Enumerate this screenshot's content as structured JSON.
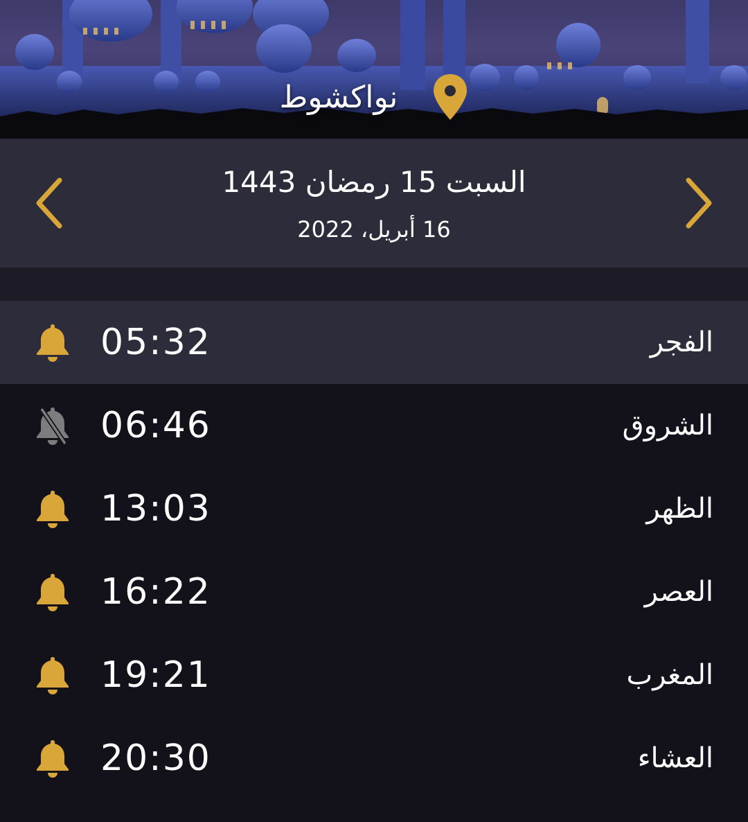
{
  "header": {
    "location_name": "نواكشوط",
    "location_icon": "map-pin-icon"
  },
  "date": {
    "hijri": "السبت 15 رمضان 1443",
    "gregorian": "16 أبريل، 2022",
    "prev_icon": "chevron-left-icon",
    "next_icon": "chevron-right-icon"
  },
  "prayers": [
    {
      "name": "الفجر",
      "time": "05:32",
      "alarm": "on",
      "active": true
    },
    {
      "name": "الشروق",
      "time": "06:46",
      "alarm": "off",
      "active": false
    },
    {
      "name": "الظهر",
      "time": "13:03",
      "alarm": "on",
      "active": false
    },
    {
      "name": "العصر",
      "time": "16:22",
      "alarm": "on",
      "active": false
    },
    {
      "name": "المغرب",
      "time": "19:21",
      "alarm": "on",
      "active": false
    },
    {
      "name": "العشاء",
      "time": "20:30",
      "alarm": "on",
      "active": false
    }
  ],
  "colors": {
    "accent": "#d9a63a",
    "background": "#13121a",
    "panel": "#2d2c3a",
    "muted_icon": "#8a8a8a"
  }
}
